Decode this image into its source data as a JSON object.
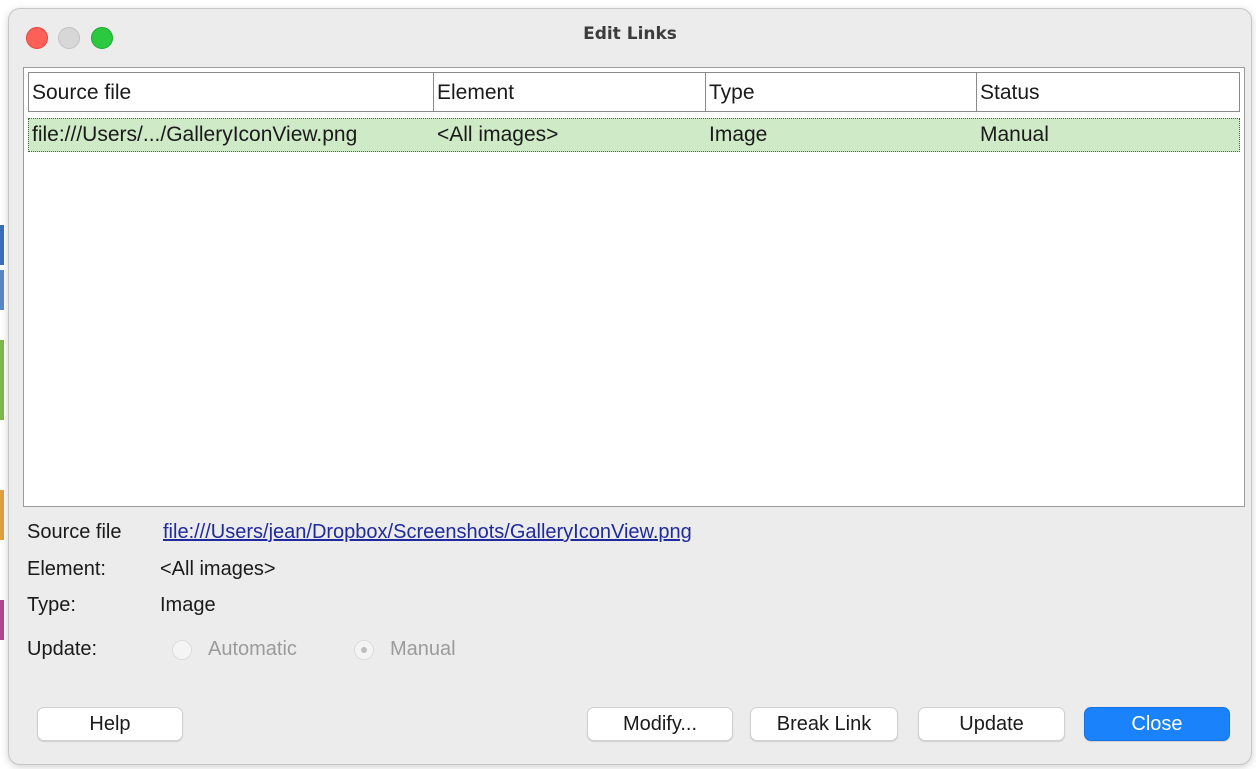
{
  "window": {
    "title": "Edit Links"
  },
  "table": {
    "columns": [
      "Source file",
      "Element",
      "Type",
      "Status"
    ],
    "rows": [
      {
        "source_file": "file:///Users/.../GalleryIconView.png",
        "element": "<All images>",
        "type": "Image",
        "status": "Manual"
      }
    ]
  },
  "details": {
    "source_file_label": "Source file",
    "source_file_value": "file:///Users/jean/Dropbox/Screenshots/GalleryIconView.png",
    "element_label": "Element:",
    "element_value": "<All images>",
    "type_label": "Type:",
    "type_value": "Image",
    "update_label": "Update:",
    "update_options": [
      "Automatic",
      "Manual"
    ],
    "update_selected": "Manual"
  },
  "buttons": {
    "help": "Help",
    "modify": "Modify...",
    "break_link": "Break Link",
    "update": "Update",
    "close": "Close"
  },
  "colors": {
    "selected_row": "#cfeac7",
    "link": "#1f2a9c",
    "primary_button": "#1a82fb",
    "traffic_close": "#fe5f57",
    "traffic_min": "#d7d7d7",
    "traffic_max": "#2ac940"
  },
  "icons": [
    "window-close-icon",
    "window-minimize-icon",
    "window-zoom-icon"
  ]
}
